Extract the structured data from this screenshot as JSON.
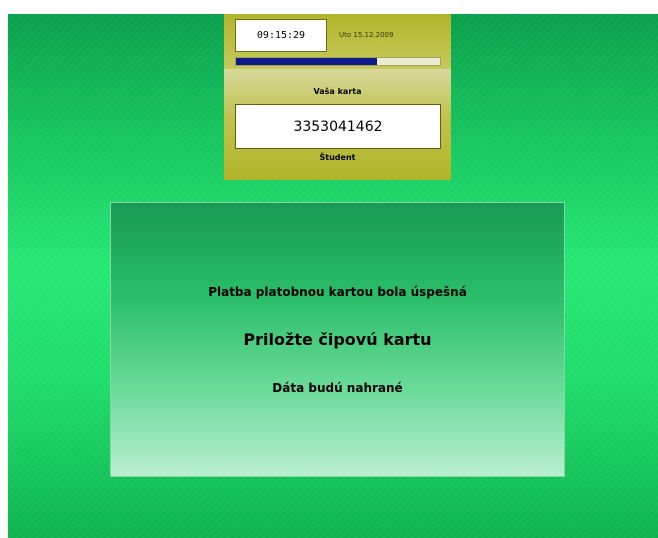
{
  "header": {
    "time": "09:15:29",
    "date": "Uto 15.12.2009",
    "progress": 0.69,
    "progress_color": "#0d1b8a"
  },
  "card": {
    "label": "Vaša karta",
    "number": "3353041462",
    "type": "Študent"
  },
  "message": {
    "line1": "Platba platobnou kartou bola úspešná",
    "line2": "Priložte čipovú kartu",
    "line3": "Dáta budú nahrané"
  },
  "colors": {
    "background_green": "#1fdd6b",
    "panel_olive": "#b6b92a"
  }
}
